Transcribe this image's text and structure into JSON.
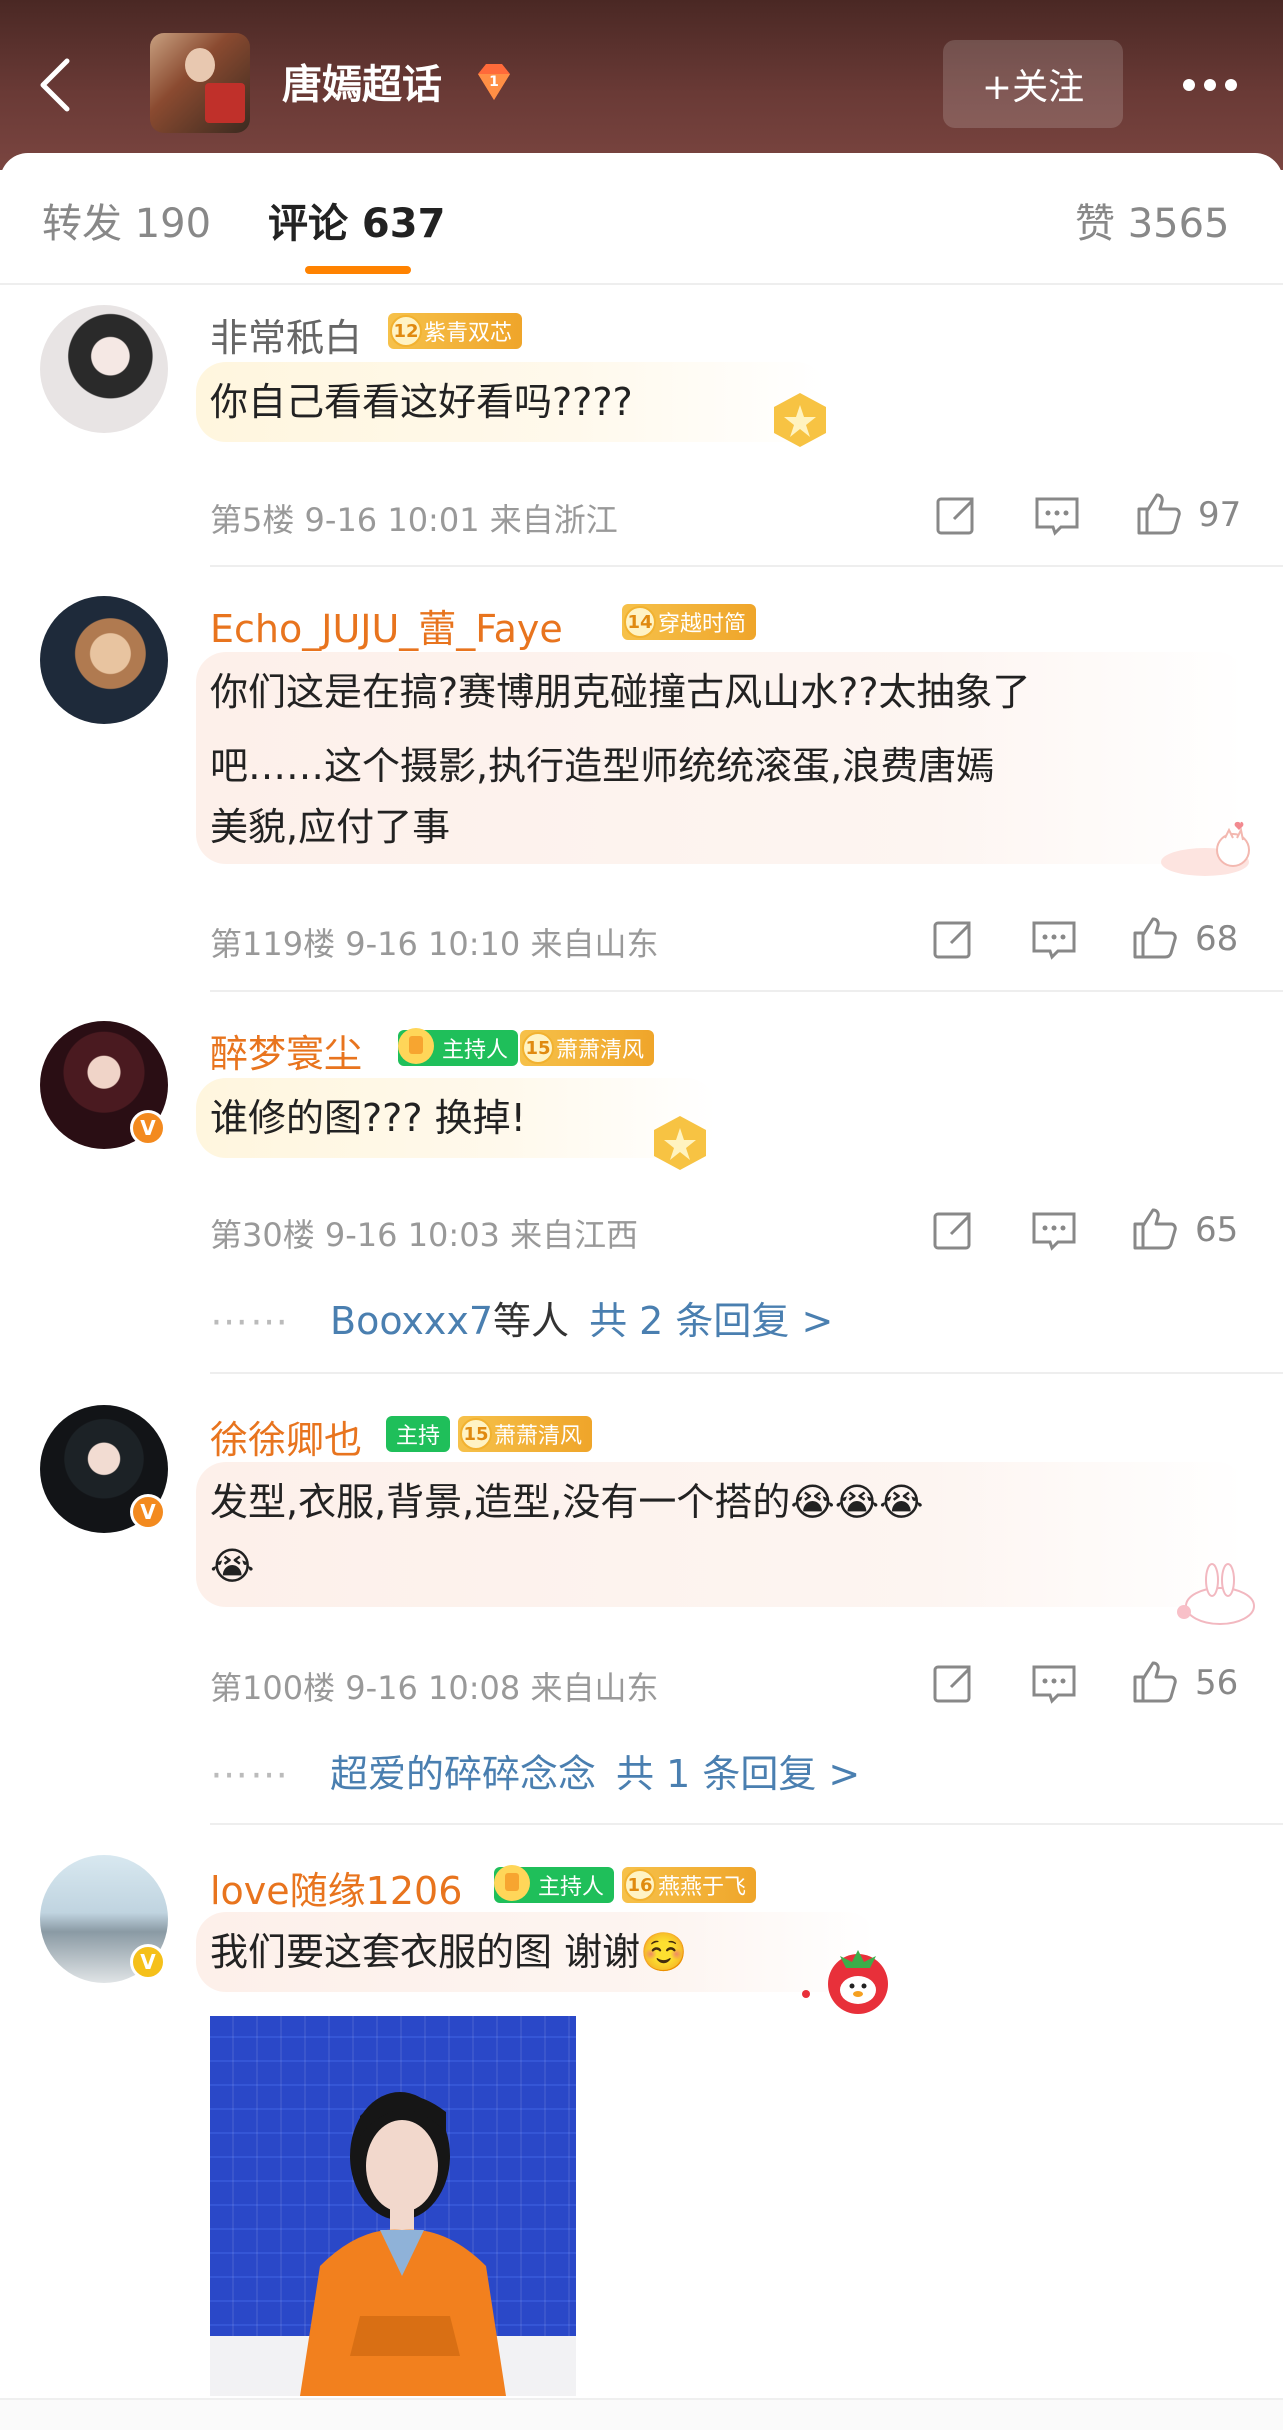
{
  "header": {
    "topic_title": "唐嫣超话",
    "follow_label": "+关注"
  },
  "tabs": [
    {
      "label": "转发 190"
    },
    {
      "label": "评论 637"
    },
    {
      "label": "赞 3565"
    }
  ],
  "comments": [
    {
      "user": "非常秖白",
      "badges": [
        {
          "level": "12",
          "text": "紫青双芯"
        }
      ],
      "text": "你自己看看这好看吗????",
      "meta": "第5楼  9-16 10:01  来自浙江",
      "likes": "97"
    },
    {
      "user": "Echo_JUJU_蕾_Faye",
      "badges": [
        {
          "level": "14",
          "text": "穿越时简"
        }
      ],
      "text_lines": [
        "你们这是在搞?赛博朋克碰撞古风山水??太抽象了",
        "吧……这个摄影,执行造型师统统滚蛋,浪费唐嫣",
        "美貌,应付了事"
      ],
      "meta": "第119楼  9-16 10:10  来自山东",
      "likes": "68"
    },
    {
      "user": "醉梦寰尘",
      "badges": [
        {
          "text": "主持人"
        },
        {
          "level": "15",
          "text": "萧萧清风"
        }
      ],
      "text": "谁修的图??? 换掉!",
      "meta": "第30楼  9-16 10:03  来自江西",
      "likes": "65",
      "reply": {
        "dots": "⋯⋯",
        "who": "Booxxx7",
        "mid": "等人",
        "count": "共 2 条回复 >"
      }
    },
    {
      "user": "徐徐卿也",
      "badges": [
        {
          "text": "主持"
        },
        {
          "level": "15",
          "text": "萧萧清风"
        }
      ],
      "text_lines": [
        "发型,衣服,背景,造型,没有一个搭的😭😭😭",
        "😭"
      ],
      "meta": "第100楼  9-16 10:08  来自山东",
      "likes": "56",
      "reply": {
        "dots": "⋯⋯",
        "who": "超爱的碎碎念念",
        "mid": "",
        "count": "共 1 条回复 >"
      }
    },
    {
      "user": "love随缘1206",
      "badges": [
        {
          "text": "主持人"
        },
        {
          "level": "16",
          "text": "燕燕于飞"
        }
      ],
      "text": "我们要这套衣服的图 谢谢☺️"
    }
  ],
  "icons": [
    "back-arrow-icon",
    "topic-gem-icon",
    "more-dots-icon",
    "share-icon",
    "comment-icon",
    "like-icon",
    "verified-v-icon"
  ],
  "colors": {
    "accent": "#ff8200",
    "username_orange": "#e8741e",
    "link_blue": "#4a7fb0",
    "header_bg": "#5a302c"
  }
}
